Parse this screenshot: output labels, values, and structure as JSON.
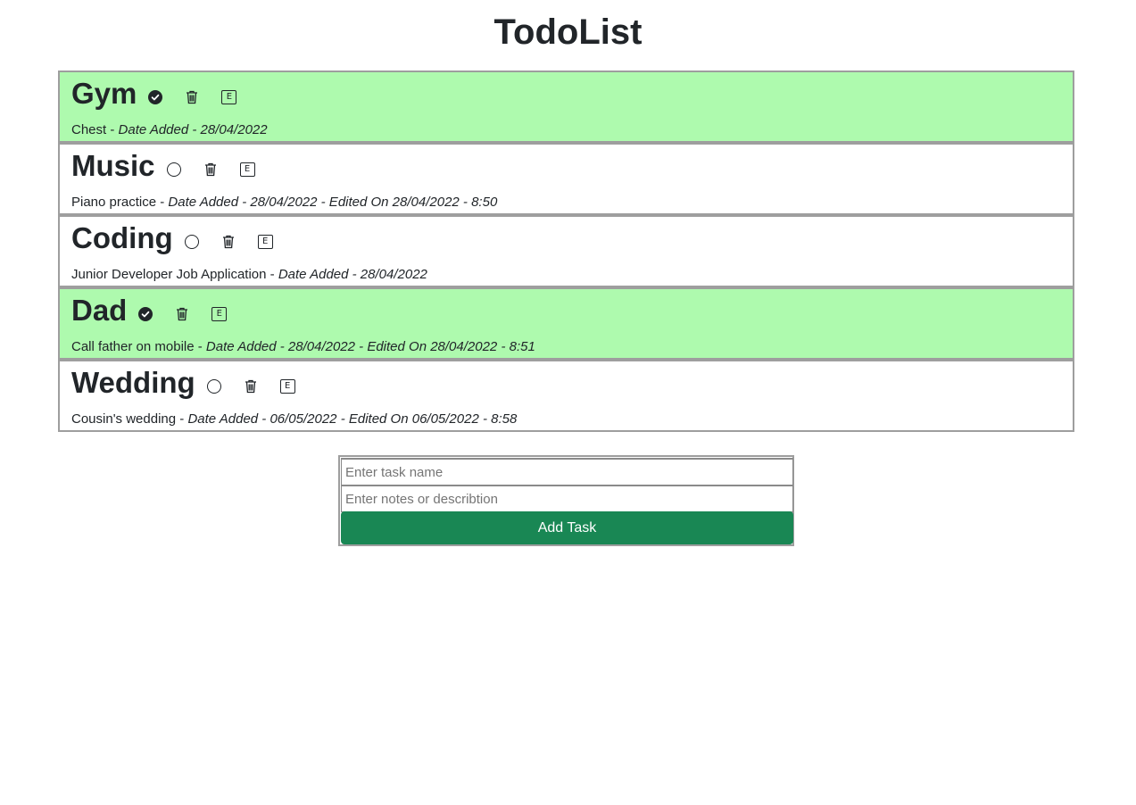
{
  "title": "TodoList",
  "tasks": [
    {
      "name": "Gym",
      "completed": true,
      "notes": "Chest",
      "meta": "Date Added - 28/04/2022"
    },
    {
      "name": "Music",
      "completed": false,
      "notes": "Piano practice",
      "meta": "Date Added - 28/04/2022 - Edited On 28/04/2022 - 8:50"
    },
    {
      "name": "Coding",
      "completed": false,
      "notes": "Junior Developer Job Application",
      "meta": "Date Added - 28/04/2022"
    },
    {
      "name": "Dad",
      "completed": true,
      "notes": "Call father on mobile",
      "meta": "Date Added - 28/04/2022 - Edited On 28/04/2022 - 8:51"
    },
    {
      "name": "Wedding",
      "completed": false,
      "notes": "Cousin's wedding",
      "meta": "Date Added - 06/05/2022 - Edited On 06/05/2022 - 8:58"
    }
  ],
  "separator": " - ",
  "edit_icon_letter": "E",
  "icons": {
    "complete": "check-circle-icon",
    "incomplete": "circle-icon",
    "delete": "trash-icon",
    "edit": "edit-icon"
  },
  "colors": {
    "completed_bg": "#aefaae",
    "button_bg": "#198754"
  },
  "form": {
    "name_placeholder": "Enter task name",
    "notes_placeholder": "Enter notes or describtion",
    "name_value": "",
    "notes_value": "",
    "add_label": "Add Task"
  }
}
